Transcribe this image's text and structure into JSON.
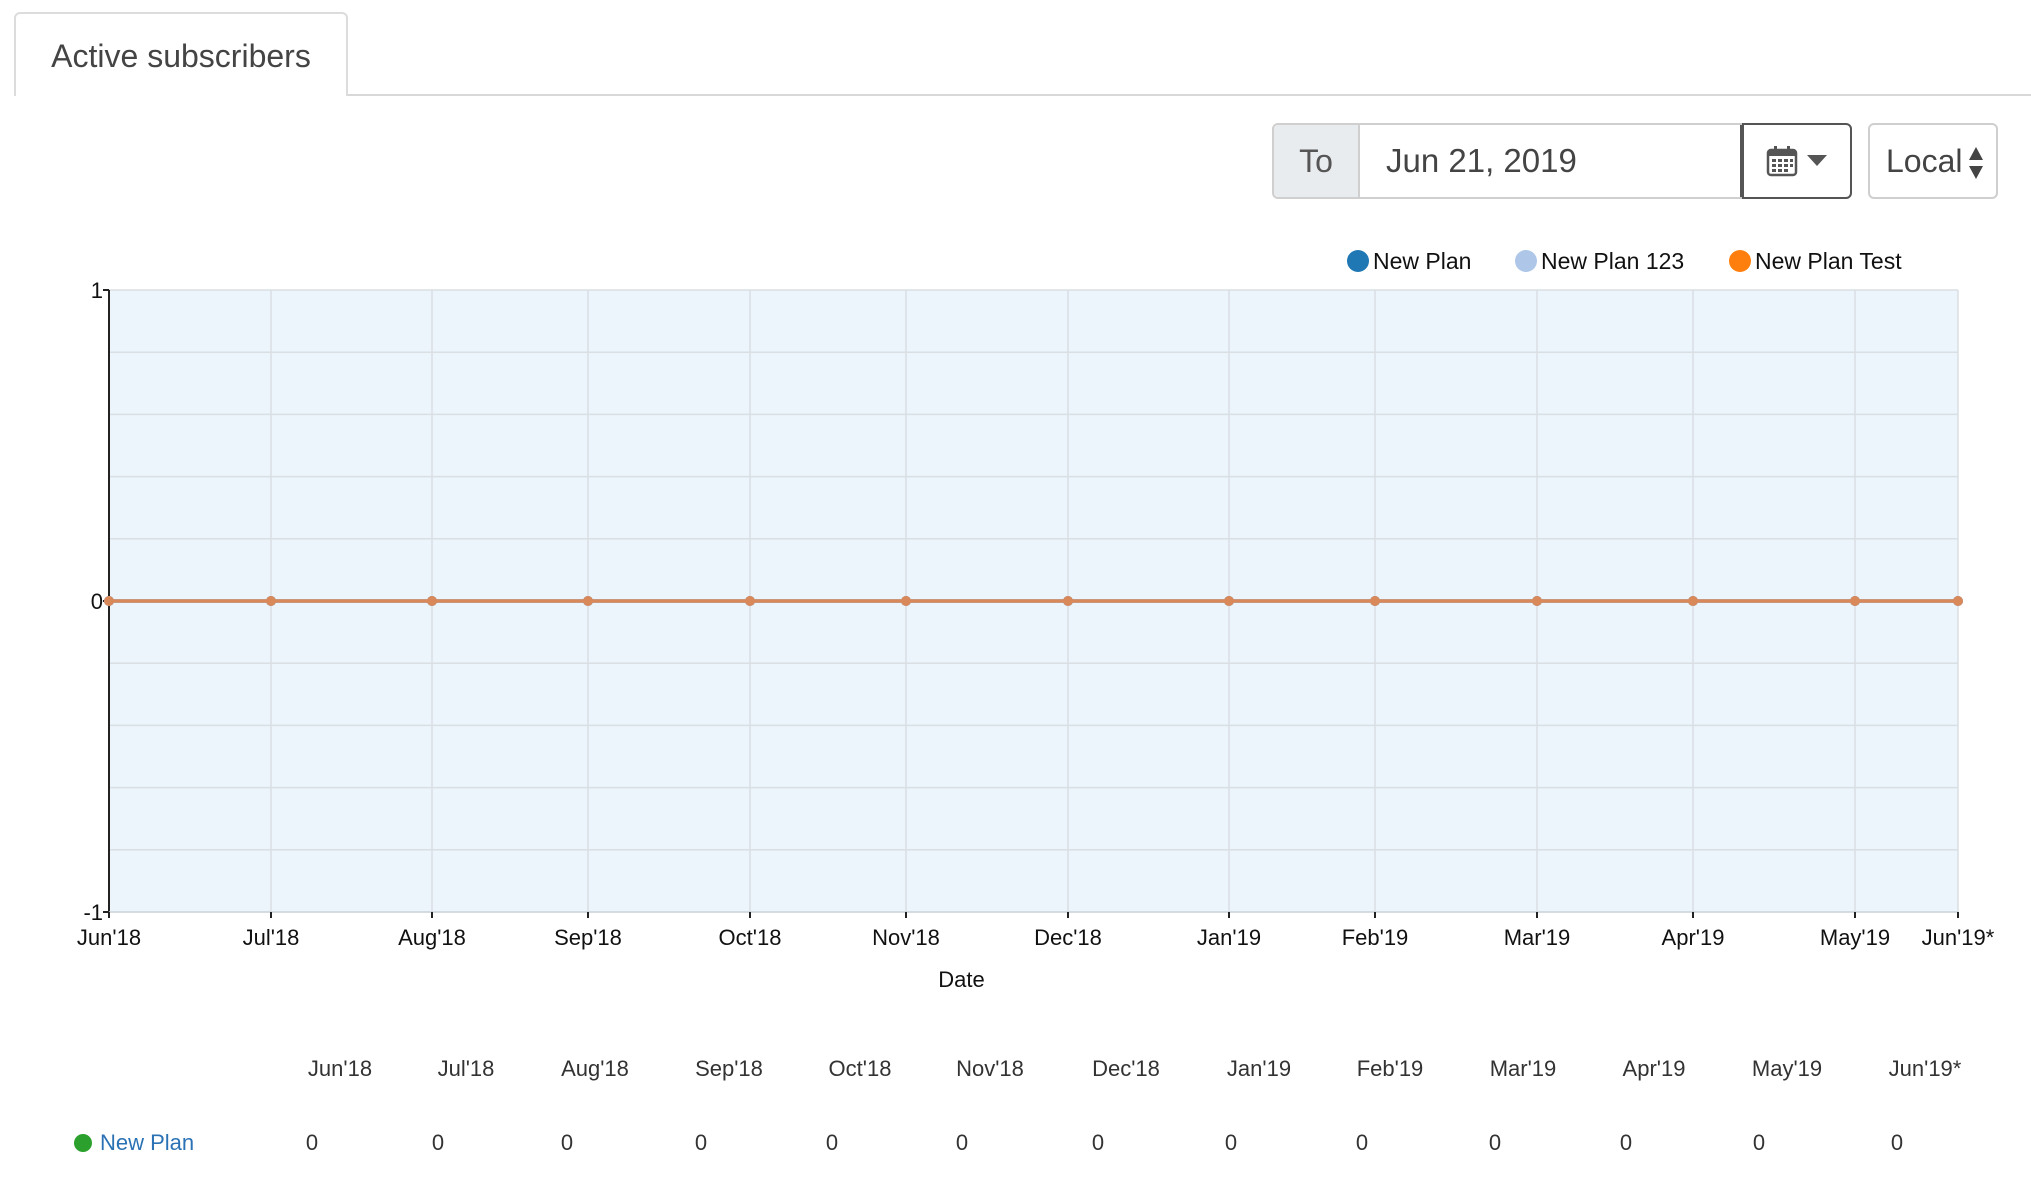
{
  "tabs": [
    {
      "label": "Active subscribers"
    }
  ],
  "date_controls": {
    "prefix": "To",
    "date_value": "Jun 21, 2019",
    "picker_icon": "calendar-icon",
    "timezone": "Local"
  },
  "colors": {
    "new_plan": "#1f77b4",
    "new_plan_123": "#aec7e8",
    "new_plan_test": "#ff7f0e",
    "plot_bg": "#ebf5fb",
    "row_dot": "#2ca02c",
    "link": "#2b72b5"
  },
  "chart_data": {
    "type": "line",
    "xlabel": "Date",
    "ylabel": "",
    "ylim": [
      -1,
      1
    ],
    "yticks": [
      -1,
      0,
      1
    ],
    "grid": true,
    "legend_position": "top-right",
    "categories": [
      "Jun'18",
      "Jul'18",
      "Aug'18",
      "Sep'18",
      "Oct'18",
      "Nov'18",
      "Dec'18",
      "Jan'19",
      "Feb'19",
      "Mar'19",
      "Apr'19",
      "May'19",
      "Jun'19*"
    ],
    "series": [
      {
        "name": "New Plan",
        "values": [
          0,
          0,
          0,
          0,
          0,
          0,
          0,
          0,
          0,
          0,
          0,
          0,
          0
        ]
      },
      {
        "name": "New Plan 123",
        "values": [
          0,
          0,
          0,
          0,
          0,
          0,
          0,
          0,
          0,
          0,
          0,
          0,
          0
        ]
      },
      {
        "name": "New Plan Test",
        "values": [
          0,
          0,
          0,
          0,
          0,
          0,
          0,
          0,
          0,
          0,
          0,
          0,
          0
        ]
      }
    ]
  },
  "table": {
    "columns": [
      "Jun'18",
      "Jul'18",
      "Aug'18",
      "Sep'18",
      "Oct'18",
      "Nov'18",
      "Dec'18",
      "Jan'19",
      "Feb'19",
      "Mar'19",
      "Apr'19",
      "May'19",
      "Jun'19*"
    ],
    "rows": [
      {
        "label": "New Plan",
        "values": [
          0,
          0,
          0,
          0,
          0,
          0,
          0,
          0,
          0,
          0,
          0,
          0,
          0
        ]
      }
    ]
  }
}
